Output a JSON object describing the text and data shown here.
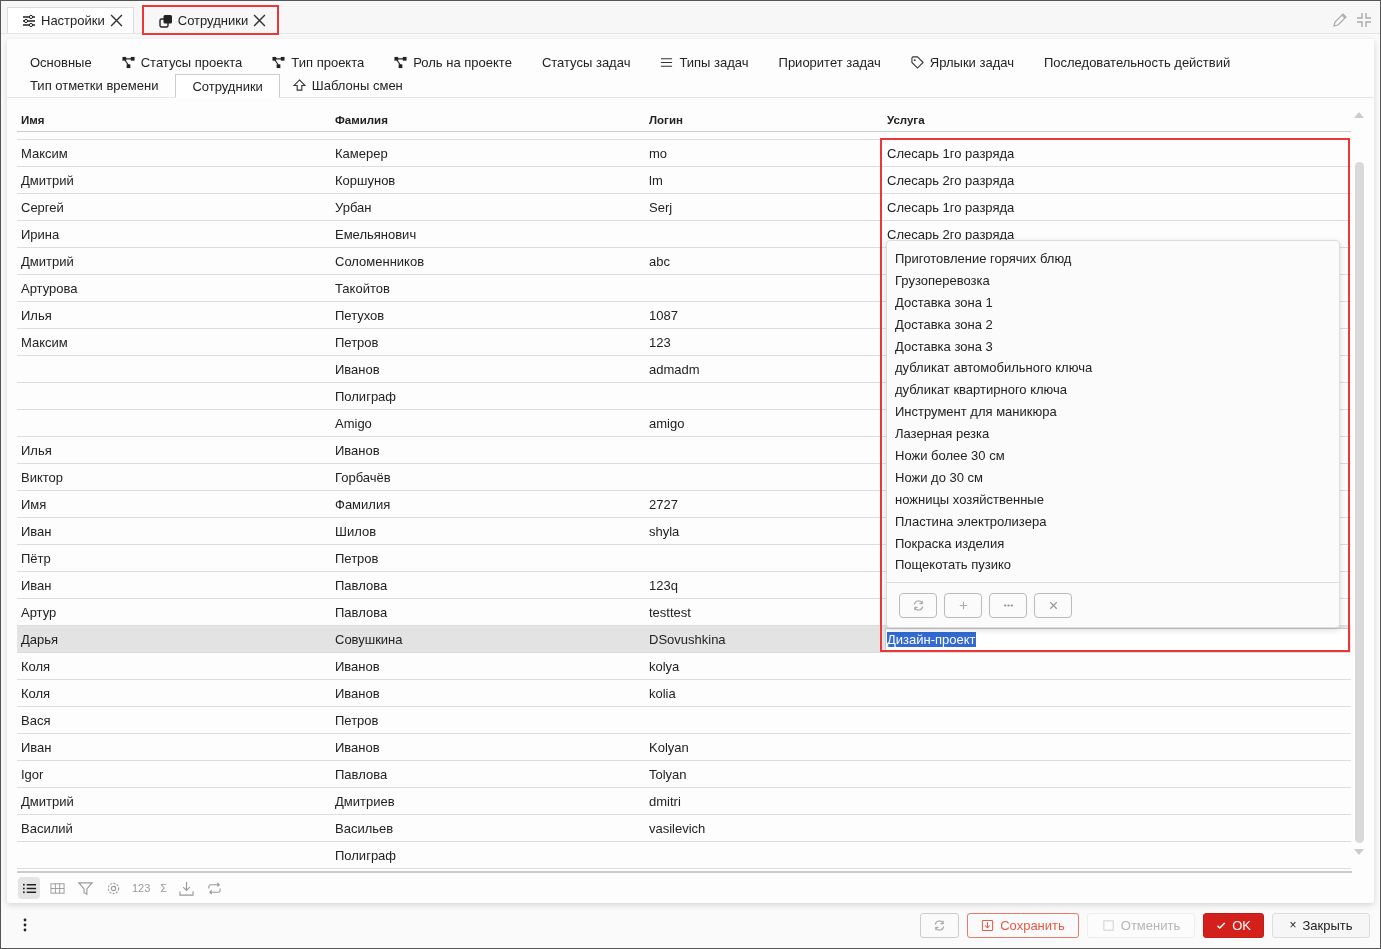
{
  "window_tabs": [
    {
      "label": "Настройки",
      "kind": "sliders",
      "selected": false,
      "highlighted": false
    },
    {
      "label": "Сотрудники",
      "kind": "copy",
      "selected": true,
      "highlighted": true
    }
  ],
  "subtabs": [
    [
      {
        "label": "Основные",
        "kind": "plain",
        "selected": false
      },
      {
        "label": "Статусы проекта",
        "kind": "tree",
        "selected": false
      },
      {
        "label": "Тип проекта",
        "kind": "tree",
        "selected": false
      },
      {
        "label": "Роль на проекте",
        "kind": "tree",
        "selected": false
      },
      {
        "label": "Статусы задач",
        "kind": "plain",
        "selected": false
      },
      {
        "label": "Типы задач",
        "kind": "list",
        "selected": false
      },
      {
        "label": "Приоритет задач",
        "kind": "plain",
        "selected": false
      },
      {
        "label": "Ярлыки задач",
        "kind": "tag",
        "selected": false
      },
      {
        "label": "Последовательность действий",
        "kind": "plain",
        "selected": false
      }
    ],
    [
      {
        "label": "Тип отметки времени",
        "kind": "plain",
        "selected": false
      },
      {
        "label": "Сотрудники",
        "kind": "plain",
        "selected": true
      },
      {
        "label": "Шаблоны смен",
        "kind": "upload",
        "selected": false
      }
    ]
  ],
  "table": {
    "columns": [
      {
        "label": "Имя",
        "highlighted": false
      },
      {
        "label": "Фамилия",
        "highlighted": false
      },
      {
        "label": "Логин",
        "highlighted": false
      },
      {
        "label": "Услуга",
        "highlighted": true
      }
    ],
    "rows": [
      {
        "cells": [
          "Максим",
          "Камерер",
          "mo",
          "Слесарь 1го разряда"
        ],
        "selected": false
      },
      {
        "cells": [
          "Дмитрий",
          "Коршунов",
          "lm",
          "Слесарь 2го разряда"
        ],
        "selected": false
      },
      {
        "cells": [
          "Сергей",
          "Урбан",
          "Serj",
          "Слесарь 1го разряда"
        ],
        "selected": false
      },
      {
        "cells": [
          "Ирина",
          "Емельянович",
          "",
          "Слесарь 2го разряда"
        ],
        "selected": false
      },
      {
        "cells": [
          "Дмитрий",
          "Соломенников",
          "abc",
          ""
        ],
        "selected": false
      },
      {
        "cells": [
          "Артурова",
          "Такойтов",
          "",
          ""
        ],
        "selected": false
      },
      {
        "cells": [
          "Илья",
          "Петухов",
          "1087",
          ""
        ],
        "selected": false
      },
      {
        "cells": [
          "Максим",
          "Петров",
          "123",
          ""
        ],
        "selected": false
      },
      {
        "cells": [
          "",
          "Иванов",
          "admadm",
          ""
        ],
        "selected": false
      },
      {
        "cells": [
          "",
          "Полиграф",
          "",
          ""
        ],
        "selected": false
      },
      {
        "cells": [
          "",
          "Amigo",
          "amigo",
          ""
        ],
        "selected": false
      },
      {
        "cells": [
          "Илья",
          "Иванов",
          "",
          ""
        ],
        "selected": false
      },
      {
        "cells": [
          "Виктор",
          "Горбачёв",
          "",
          ""
        ],
        "selected": false
      },
      {
        "cells": [
          "Имя",
          "Фамилия",
          "2727",
          ""
        ],
        "selected": false
      },
      {
        "cells": [
          "Иван",
          "Шилов",
          "shyla",
          ""
        ],
        "selected": false
      },
      {
        "cells": [
          "Пётр",
          "Петров",
          "",
          ""
        ],
        "selected": false
      },
      {
        "cells": [
          "Иван",
          "Павлова",
          "123q",
          ""
        ],
        "selected": false
      },
      {
        "cells": [
          "Артур",
          "Павлова",
          "testtest",
          ""
        ],
        "selected": false
      },
      {
        "cells": [
          "Дарья",
          "Совушкина",
          "DSovushkina",
          ""
        ],
        "selected": true,
        "editor": {
          "value": "Дизайн-проект",
          "text_selected": true
        }
      },
      {
        "cells": [
          "Коля",
          "Иванов",
          "kolya",
          ""
        ],
        "selected": false
      },
      {
        "cells": [
          "Коля",
          "Иванов",
          "kolia",
          ""
        ],
        "selected": false
      },
      {
        "cells": [
          "Вася",
          "Петров",
          "",
          ""
        ],
        "selected": false
      },
      {
        "cells": [
          "Иван",
          "Иванов",
          "Kolyan",
          ""
        ],
        "selected": false
      },
      {
        "cells": [
          "Igor",
          "Павлова",
          "Tolyan",
          ""
        ],
        "selected": false
      },
      {
        "cells": [
          "Дмитрий",
          "Дмитриев",
          "dmitri",
          ""
        ],
        "selected": false
      },
      {
        "cells": [
          "Василий",
          "Васильев",
          "vasilevich",
          ""
        ],
        "selected": false
      },
      {
        "cells": [
          "",
          "Полиграф",
          "",
          ""
        ],
        "selected": false
      }
    ]
  },
  "dropdown": {
    "options": [
      "Приготовление горячих блюд",
      "Грузоперевозка",
      "Доставка зона 1",
      "Доставка зона 2",
      "Доставка зона 3",
      "дубликат автомобильного ключа",
      "дубликат квартирного ключа",
      "Инструмент для маникюра",
      "Лазерная резка",
      "Ножи более 30 см",
      "Ножи до 30 см",
      "ножницы хозяйственные",
      "Пластина электролизера",
      "Покраска изделия",
      "Пощекотать пузико"
    ],
    "buttons": [
      {
        "kind": "refresh"
      },
      {
        "kind": "add"
      },
      {
        "kind": "more"
      },
      {
        "kind": "clear"
      }
    ]
  },
  "toolbar": [
    {
      "kind": "list",
      "selected": true
    },
    {
      "kind": "grid",
      "selected": false
    },
    {
      "kind": "filter",
      "selected": false
    },
    {
      "kind": "gear",
      "selected": false
    },
    {
      "kind": "text",
      "label": "123",
      "selected": false
    },
    {
      "kind": "text",
      "label": "Σ",
      "selected": false
    },
    {
      "kind": "download",
      "selected": false
    },
    {
      "kind": "repeat",
      "selected": false
    }
  ],
  "footer_buttons": [
    {
      "kind": "refresh",
      "disabled": false
    },
    {
      "kind": "save",
      "label": "Сохранить",
      "disabled": false
    },
    {
      "kind": "cancel",
      "label": "Отменить",
      "disabled": true
    },
    {
      "kind": "ok",
      "label": "OK",
      "disabled": false
    },
    {
      "kind": "close",
      "label": "Закрыть",
      "mark": "×",
      "disabled": false
    }
  ]
}
